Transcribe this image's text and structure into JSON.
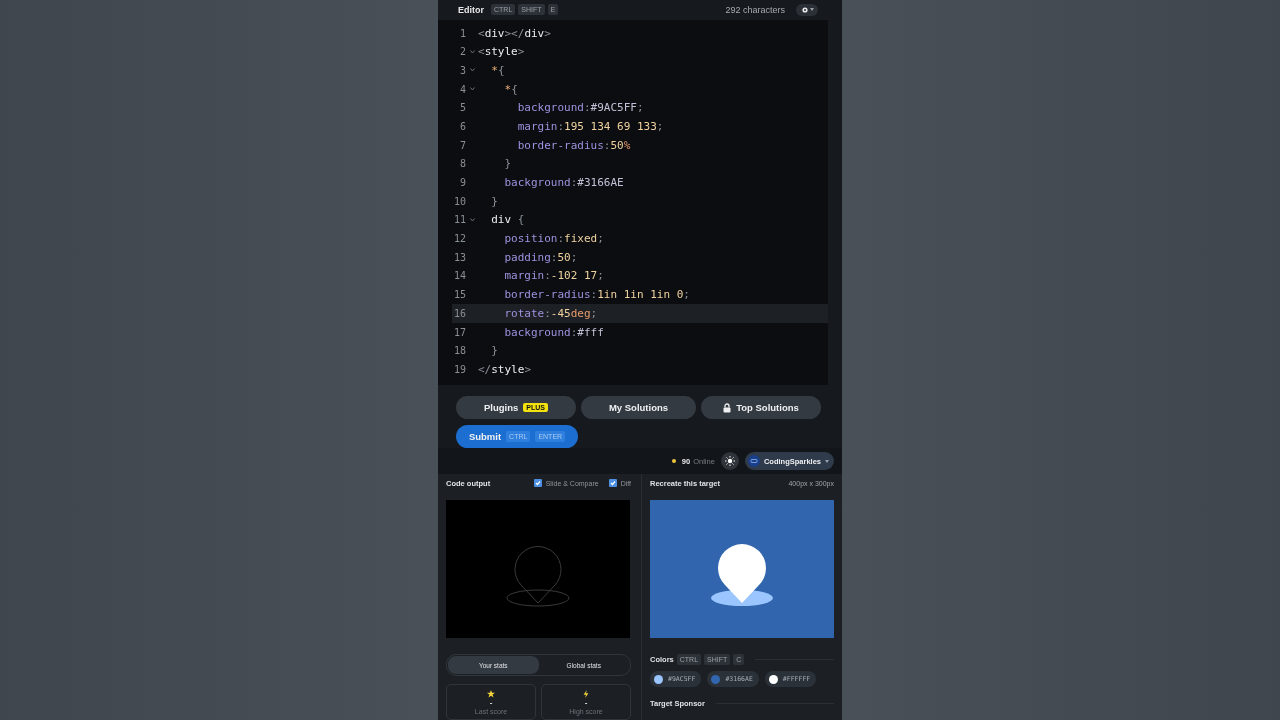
{
  "editor": {
    "title": "Editor",
    "shortcut": [
      "CTRL",
      "SHIFT",
      "E"
    ],
    "char_count": "292 characters",
    "lines": [
      {
        "number": "1",
        "foldable": false,
        "active": false,
        "tokens": [
          {
            "kind": "punct",
            "text": "<"
          },
          {
            "kind": "tag",
            "text": "div"
          },
          {
            "kind": "punct",
            "text": "></"
          },
          {
            "kind": "tag",
            "text": "div"
          },
          {
            "kind": "punct",
            "text": ">"
          }
        ]
      },
      {
        "number": "2",
        "foldable": true,
        "active": false,
        "tokens": [
          {
            "kind": "punct",
            "text": "<"
          },
          {
            "kind": "tag",
            "text": "style"
          },
          {
            "kind": "punct",
            "text": ">"
          }
        ]
      },
      {
        "number": "3",
        "foldable": true,
        "active": false,
        "tokens": [
          {
            "kind": "sel",
            "text": "  *"
          },
          {
            "kind": "punct",
            "text": "{"
          }
        ]
      },
      {
        "number": "4",
        "foldable": true,
        "active": false,
        "tokens": [
          {
            "kind": "sel",
            "text": "    *"
          },
          {
            "kind": "punct",
            "text": "{"
          }
        ]
      },
      {
        "number": "5",
        "foldable": false,
        "active": false,
        "tokens": [
          {
            "kind": "prop",
            "text": "      background"
          },
          {
            "kind": "punct",
            "text": ":"
          },
          {
            "kind": "val",
            "text": "#9AC5FF"
          },
          {
            "kind": "punct",
            "text": ";"
          }
        ]
      },
      {
        "number": "6",
        "foldable": false,
        "active": false,
        "tokens": [
          {
            "kind": "prop",
            "text": "      margin"
          },
          {
            "kind": "punct",
            "text": ":"
          },
          {
            "kind": "num",
            "text": "195 134 69 133"
          },
          {
            "kind": "punct",
            "text": ";"
          }
        ]
      },
      {
        "number": "7",
        "foldable": false,
        "active": false,
        "tokens": [
          {
            "kind": "prop",
            "text": "      border-radius"
          },
          {
            "kind": "punct",
            "text": ":"
          },
          {
            "kind": "num",
            "text": "50"
          },
          {
            "kind": "unit",
            "text": "%"
          }
        ]
      },
      {
        "number": "8",
        "foldable": false,
        "active": false,
        "tokens": [
          {
            "kind": "punct",
            "text": "    }"
          }
        ]
      },
      {
        "number": "9",
        "foldable": false,
        "active": false,
        "tokens": [
          {
            "kind": "prop",
            "text": "    background"
          },
          {
            "kind": "punct",
            "text": ":"
          },
          {
            "kind": "val",
            "text": "#3166AE"
          }
        ]
      },
      {
        "number": "10",
        "foldable": false,
        "active": false,
        "tokens": [
          {
            "kind": "punct",
            "text": "  }"
          }
        ]
      },
      {
        "number": "11",
        "foldable": true,
        "active": false,
        "tokens": [
          {
            "kind": "tag",
            "text": "  div "
          },
          {
            "kind": "punct",
            "text": "{"
          }
        ]
      },
      {
        "number": "12",
        "foldable": false,
        "active": false,
        "tokens": [
          {
            "kind": "prop",
            "text": "    position"
          },
          {
            "kind": "punct",
            "text": ":"
          },
          {
            "kind": "num",
            "text": "fixed"
          },
          {
            "kind": "punct",
            "text": ";"
          }
        ]
      },
      {
        "number": "13",
        "foldable": false,
        "active": false,
        "tokens": [
          {
            "kind": "prop",
            "text": "    padding"
          },
          {
            "kind": "punct",
            "text": ":"
          },
          {
            "kind": "num",
            "text": "50"
          },
          {
            "kind": "punct",
            "text": ";"
          }
        ]
      },
      {
        "number": "14",
        "foldable": false,
        "active": false,
        "tokens": [
          {
            "kind": "prop",
            "text": "    margin"
          },
          {
            "kind": "punct",
            "text": ":"
          },
          {
            "kind": "num",
            "text": "-102 17"
          },
          {
            "kind": "punct",
            "text": ";"
          }
        ]
      },
      {
        "number": "15",
        "foldable": false,
        "active": false,
        "tokens": [
          {
            "kind": "prop",
            "text": "    border-radius"
          },
          {
            "kind": "punct",
            "text": ":"
          },
          {
            "kind": "num",
            "text": "1in 1in 1in 0"
          },
          {
            "kind": "punct",
            "text": ";"
          }
        ]
      },
      {
        "number": "16",
        "foldable": false,
        "active": true,
        "tokens": [
          {
            "kind": "prop",
            "text": "    rotate"
          },
          {
            "kind": "punct",
            "text": ":"
          },
          {
            "kind": "num",
            "text": "-45"
          },
          {
            "kind": "unit",
            "text": "deg"
          },
          {
            "kind": "punct",
            "text": ";"
          }
        ]
      },
      {
        "number": "17",
        "foldable": false,
        "active": false,
        "tokens": [
          {
            "kind": "prop",
            "text": "    background"
          },
          {
            "kind": "punct",
            "text": ":"
          },
          {
            "kind": "val",
            "text": "#fff"
          }
        ]
      },
      {
        "number": "18",
        "foldable": false,
        "active": false,
        "tokens": [
          {
            "kind": "punct",
            "text": "  }"
          }
        ]
      },
      {
        "number": "19",
        "foldable": false,
        "active": false,
        "tokens": [
          {
            "kind": "punct",
            "text": "</"
          },
          {
            "kind": "tag",
            "text": "style"
          },
          {
            "kind": "punct",
            "text": ">"
          }
        ]
      }
    ]
  },
  "actions": {
    "buttons": [
      {
        "label": "Plugins",
        "badge": "PLUS",
        "locked": false
      },
      {
        "label": "My Solutions",
        "locked": false
      },
      {
        "label": "Top Solutions",
        "locked": true
      }
    ],
    "submit": {
      "label": "Submit",
      "shortcut": [
        "CTRL",
        "ENTER"
      ]
    }
  },
  "topbar": {
    "online_count": "90",
    "online_label": "Online",
    "username": "CodingSparkles"
  },
  "output": {
    "title": "Code output",
    "options": [
      {
        "label": "Slide & Compare",
        "checked": true
      },
      {
        "label": "Diff",
        "checked": true
      }
    ]
  },
  "stats": {
    "tabs": [
      {
        "label": "Your stats",
        "selected": true
      },
      {
        "label": "Global stats",
        "selected": false
      }
    ],
    "cards": [
      {
        "kind": "star",
        "value": "-",
        "label": "Last score"
      },
      {
        "kind": "bolt",
        "value": "-",
        "label": "High score"
      }
    ]
  },
  "target": {
    "title": "Recreate this target",
    "size": "400px x 300px",
    "colors_title": "Colors",
    "colors_shortcut": [
      "CTRL",
      "SHIFT",
      "C"
    ],
    "colors": [
      {
        "label": "#9AC5FF",
        "color": "#9ac5ff"
      },
      {
        "label": "#3166AE",
        "color": "#3166ae"
      },
      {
        "label": "#FFFFFF",
        "color": "#ffffff"
      }
    ],
    "sponsor_title": "Target Sponsor"
  }
}
